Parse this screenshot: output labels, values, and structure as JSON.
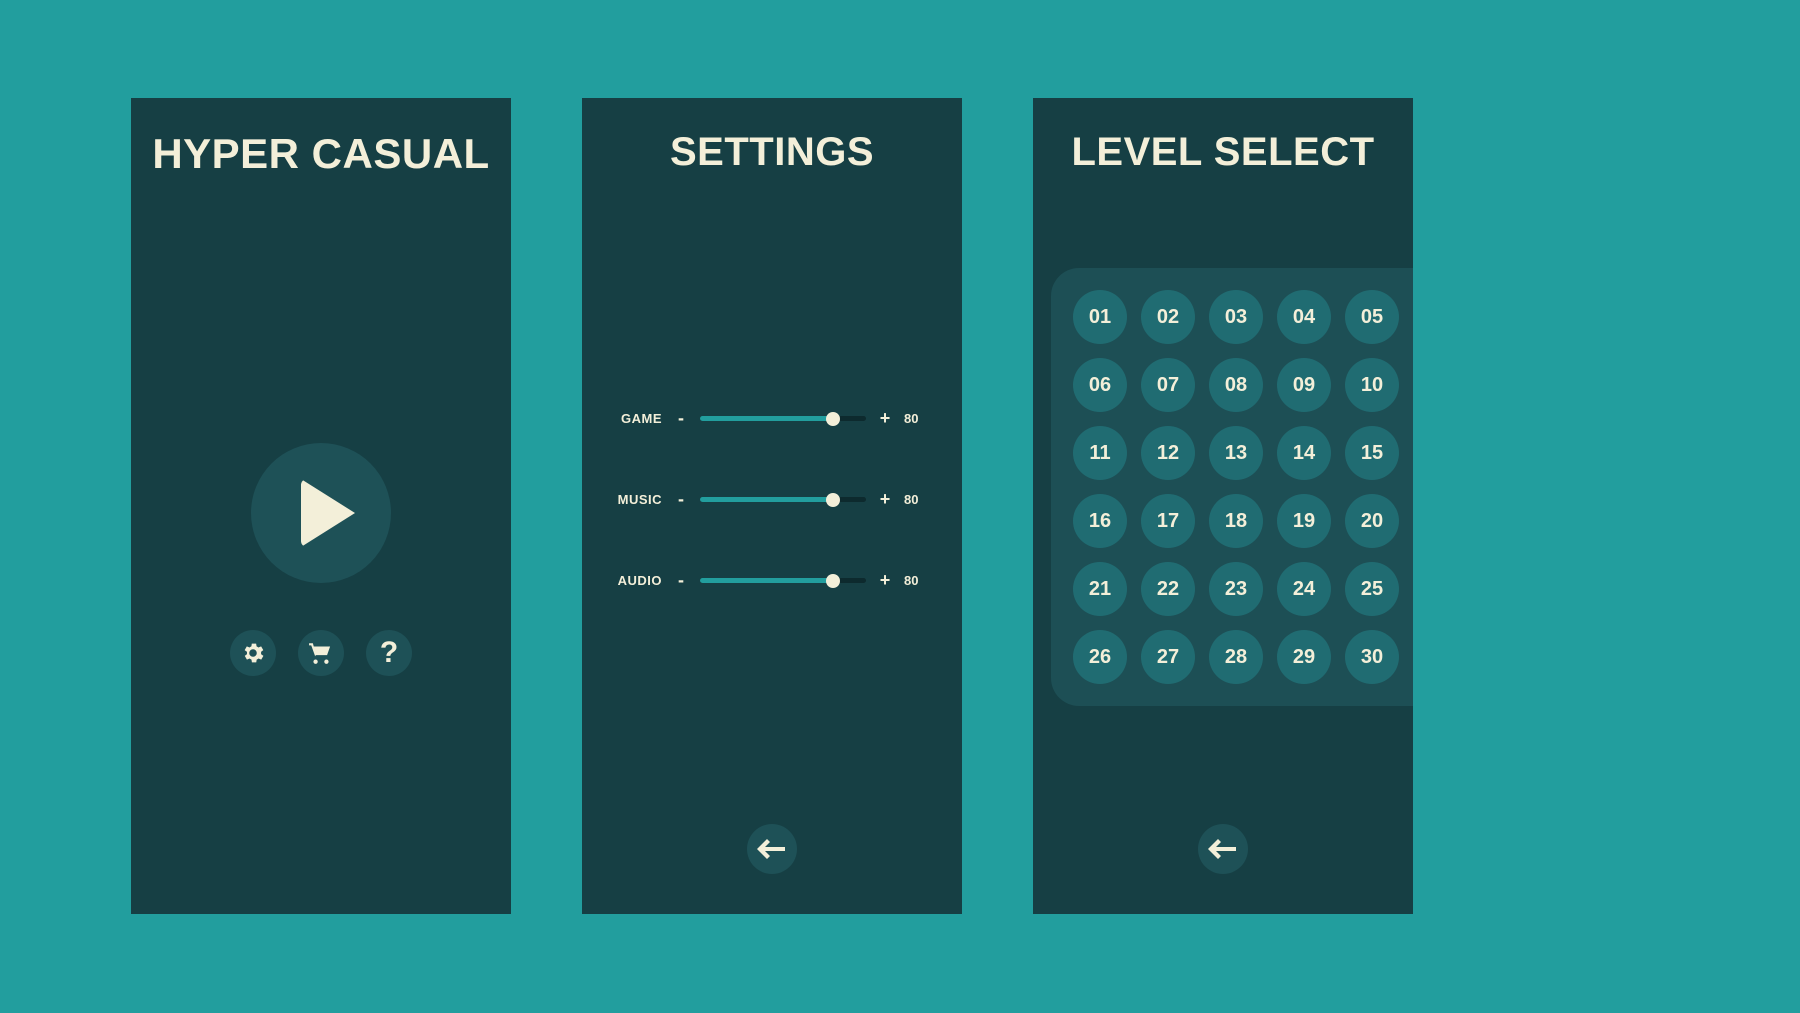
{
  "colors": {
    "bg": "#229e9e",
    "panel": "#163f44",
    "accent": "#1e5157",
    "light": "#f3efd9",
    "level_panel": "#1d4f55",
    "level_cell": "#206c72",
    "slider_empty": "#0d2a2e"
  },
  "main": {
    "title": "HYPER CASUAL",
    "icons": [
      "settings",
      "cart",
      "help"
    ]
  },
  "settings": {
    "title": "SETTINGS",
    "sliders": [
      {
        "label": "GAME",
        "value": 80
      },
      {
        "label": "MUSIC",
        "value": 80
      },
      {
        "label": "AUDIO",
        "value": 80
      }
    ],
    "minus": "-",
    "plus": "+"
  },
  "levels": {
    "title": "LEVEL SELECT",
    "items": [
      "01",
      "02",
      "03",
      "04",
      "05",
      "06",
      "07",
      "08",
      "09",
      "10",
      "11",
      "12",
      "13",
      "14",
      "15",
      "16",
      "17",
      "18",
      "19",
      "20",
      "21",
      "22",
      "23",
      "24",
      "25",
      "26",
      "27",
      "28",
      "29",
      "30"
    ]
  }
}
